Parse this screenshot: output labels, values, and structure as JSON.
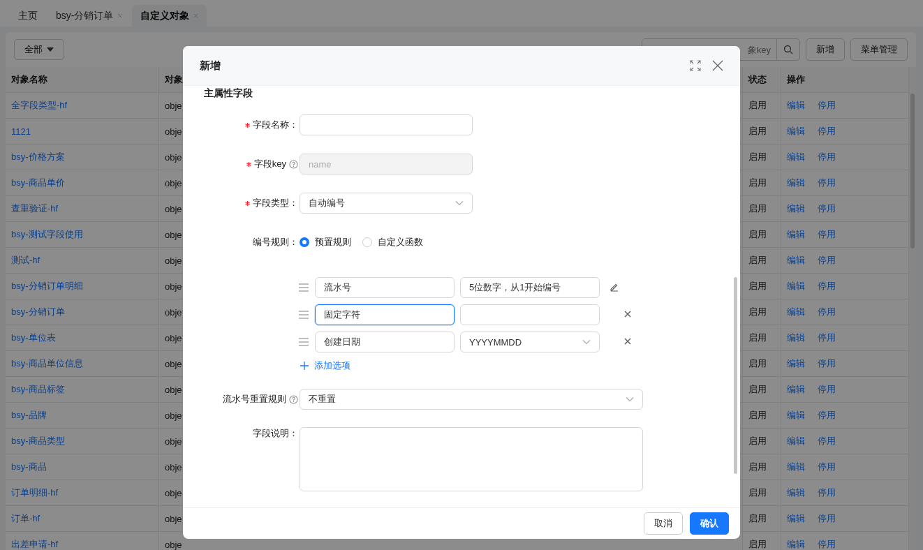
{
  "tabs": [
    {
      "label": "主页",
      "closable": false,
      "selected": false
    },
    {
      "label": "bsy-分销订单",
      "closable": true,
      "selected": false
    },
    {
      "label": "自定义对象",
      "closable": true,
      "selected": true
    }
  ],
  "toolbar": {
    "filter": "全部",
    "search_placeholder": "象key",
    "buttons": [
      "新增",
      "菜单管理"
    ]
  },
  "table": {
    "columns": [
      "对象名称",
      "对象",
      "状态",
      "操作"
    ],
    "rows": [
      {
        "name": "全字段类型-hf",
        "key": "obje",
        "status": "启用",
        "actions": [
          "编辑",
          "停用"
        ]
      },
      {
        "name": "1121",
        "key": "obje",
        "status": "启用",
        "actions": [
          "编辑",
          "停用"
        ]
      },
      {
        "name": "bsy-价格方案",
        "key": "obje",
        "status": "启用",
        "actions": [
          "编辑",
          "停用"
        ]
      },
      {
        "name": "bsy-商品单价",
        "key": "obje",
        "status": "启用",
        "actions": [
          "编辑",
          "停用"
        ]
      },
      {
        "name": "查重验证-hf",
        "key": "obje",
        "status": "启用",
        "actions": [
          "编辑",
          "停用"
        ]
      },
      {
        "name": "bsy-测试字段使用",
        "key": "obje",
        "status": "启用",
        "actions": [
          "编辑",
          "停用"
        ]
      },
      {
        "name": "测试-hf",
        "key": "obje",
        "status": "启用",
        "actions": [
          "编辑",
          "停用"
        ]
      },
      {
        "name": "bsy-分销订单明细",
        "key": "obje",
        "status": "启用",
        "actions": [
          "编辑",
          "停用"
        ]
      },
      {
        "name": "bsy-分销订单",
        "key": "obje",
        "status": "启用",
        "actions": [
          "编辑",
          "停用"
        ]
      },
      {
        "name": "bsy-单位表",
        "key": "obje",
        "status": "启用",
        "actions": [
          "编辑",
          "停用"
        ]
      },
      {
        "name": "bsy-商品单位信息",
        "key": "obje",
        "status": "启用",
        "actions": [
          "编辑",
          "停用"
        ]
      },
      {
        "name": "bsy-商品标签",
        "key": "obje",
        "status": "启用",
        "actions": [
          "编辑",
          "停用"
        ]
      },
      {
        "name": "bsy-品牌",
        "key": "obje",
        "status": "启用",
        "actions": [
          "编辑",
          "停用"
        ]
      },
      {
        "name": "bsy-商品类型",
        "key": "obje",
        "status": "启用",
        "actions": [
          "编辑",
          "停用"
        ]
      },
      {
        "name": "bsy-商品",
        "key": "obje",
        "status": "启用",
        "actions": [
          "编辑",
          "停用"
        ]
      },
      {
        "name": "订单明细-hf",
        "key": "obje",
        "status": "启用",
        "actions": [
          "编辑",
          "停用"
        ]
      },
      {
        "name": "订单-hf",
        "key": "obje",
        "status": "启用",
        "actions": [
          "编辑",
          "停用"
        ]
      },
      {
        "name": "出差申请-hf",
        "key": "obje",
        "status": "启用",
        "actions": [
          "编辑",
          "停用"
        ]
      }
    ]
  },
  "dialog": {
    "title": "新增",
    "section": "主属性字段",
    "fields": [
      {
        "kind": "input",
        "label": "字段名称：",
        "required": true,
        "help": false,
        "disabled": false
      },
      {
        "kind": "input",
        "label": "字段key",
        "required": true,
        "help": true,
        "disabled": true,
        "placeholder": "name"
      },
      {
        "kind": "select",
        "label": "字段类型：",
        "required": true,
        "help": false,
        "value": "自动编号"
      },
      {
        "kind": "radio",
        "label": "编号规则：",
        "required": false,
        "help": false,
        "options": [
          {
            "label": "预置规则",
            "selected": true
          },
          {
            "label": "自定义函数",
            "selected": false
          }
        ]
      },
      {
        "kind": "rules",
        "rules": [
          {
            "kind": "text",
            "name": "流水号",
            "focused": false,
            "value": "5位数字，从1开始编号",
            "removable": false
          },
          {
            "kind": "text",
            "name": "固定字符",
            "focused": true,
            "removable": true
          },
          {
            "kind": "select",
            "name": "创建日期",
            "focused": false,
            "value": "YYYYMMDD",
            "removable": true
          }
        ],
        "add_label": "添加选项"
      },
      {
        "kind": "wide_select",
        "label": "流水号重置规则",
        "required": false,
        "help": true,
        "value": "不重置"
      },
      {
        "kind": "textarea",
        "label": "字段说明：",
        "required": false,
        "help": false
      }
    ],
    "buttons": [
      {
        "label": "取消",
        "primary": false
      },
      {
        "label": "确认",
        "primary": true
      }
    ]
  }
}
